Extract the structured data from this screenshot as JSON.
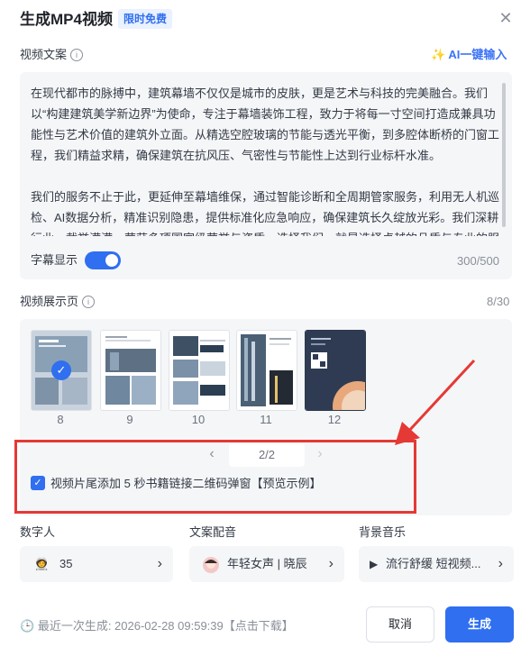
{
  "header": {
    "title": "生成MP4视频",
    "badge": "限时免费"
  },
  "copy_section": {
    "label": "视频文案",
    "ai_button": "AI一键输入",
    "paragraphs": [
      "在现代都市的脉搏中，建筑幕墙不仅仅是城市的皮肤，更是艺术与科技的完美融合。我们以“构建建筑美学新边界”为使命，专注于幕墙装饰工程，致力于将每一寸空间打造成兼具功能性与艺术价值的建筑外立面。从精选空腔玻璃的节能与透光平衡，到多腔体断桥的门窗工程，我们精益求精，确保建筑在抗风压、气密性与节能性上达到行业标杆水准。",
      "我们的服务不止于此，更延伸至幕墙维保，通过智能诊断和全周期管家服务，利用无人机巡检、AI数据分析，精准识别隐患，提供标准化应急响应，确保建筑长久绽放光彩。我们深耕行业，载誉满满，荣获多项国家级荣誉与资质。选择我们，就是选择卓越的品质与专业的服"
    ],
    "subtitle_label": "字幕显示",
    "subtitle_on": true,
    "counter": "300/500"
  },
  "pages_section": {
    "label": "视频展示页",
    "counter": "8/30",
    "thumbnails": [
      {
        "num": "8",
        "selected": true
      },
      {
        "num": "9",
        "selected": false
      },
      {
        "num": "10",
        "selected": false
      },
      {
        "num": "11",
        "selected": false
      },
      {
        "num": "12",
        "selected": false
      }
    ],
    "pager": "2/2",
    "qr_option": {
      "checked": true,
      "label": "视频片尾添加 5 秒书籍链接二维码弹窗【预览示例】"
    }
  },
  "settings": {
    "digital_human": {
      "label": "数字人",
      "value": "35"
    },
    "voice": {
      "label": "文案配音",
      "value": "年轻女声 | 晓辰"
    },
    "music": {
      "label": "背景音乐",
      "value": "流行舒缓 短视频..."
    }
  },
  "footer": {
    "last_generated": "最近一次生成: 2026-02-28 09:59:39【点击下载】",
    "cancel": "取消",
    "generate": "生成"
  },
  "colors": {
    "accent": "#2f6ff0",
    "highlight": "#e53935"
  }
}
